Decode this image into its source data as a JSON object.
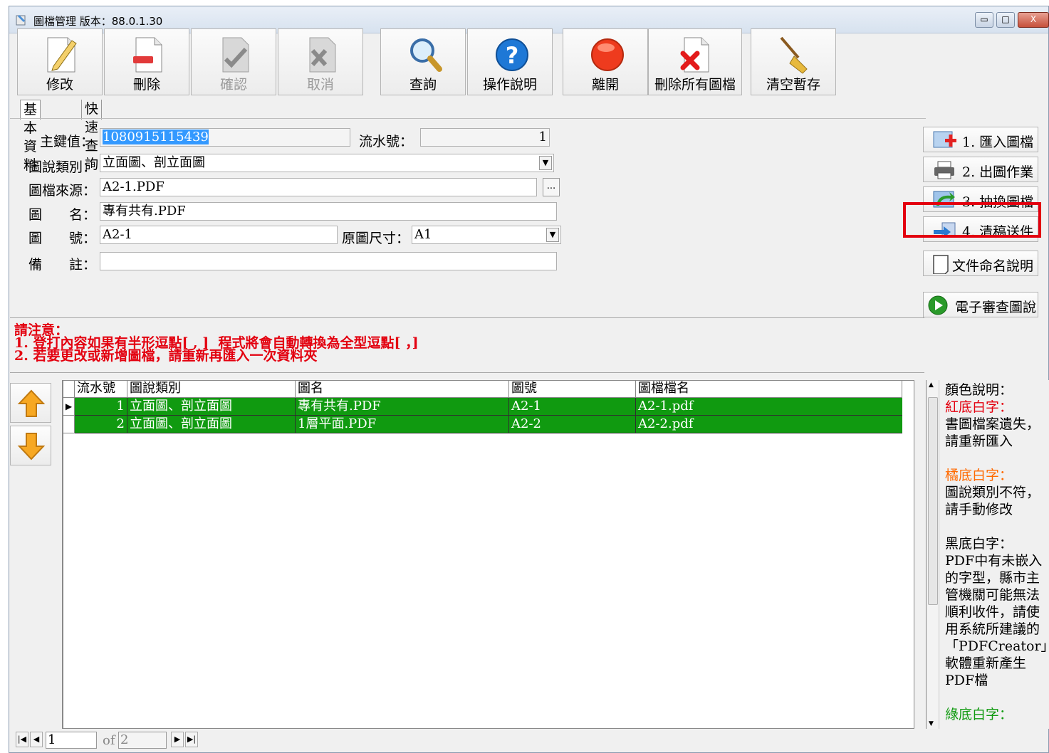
{
  "window": {
    "title": "圖檔管理 版本：88.0.1.30",
    "minimize": "▭",
    "maximize": "□",
    "close": "X"
  },
  "toolbar": [
    {
      "label": "修改",
      "icon": "edit-icon",
      "enabled": true
    },
    {
      "label": "刪除",
      "icon": "delete-doc-icon",
      "enabled": true
    },
    {
      "label": "確認",
      "icon": "confirm-icon",
      "enabled": false
    },
    {
      "label": "取消",
      "icon": "cancel-icon",
      "enabled": false
    },
    {
      "label": "查詢",
      "icon": "search-icon",
      "enabled": true
    },
    {
      "label": "操作說明",
      "icon": "help-icon",
      "enabled": true
    },
    {
      "label": "離開",
      "icon": "exit-icon",
      "enabled": true
    },
    {
      "label": "刪除所有圖檔",
      "icon": "delete-all-icon",
      "enabled": true
    },
    {
      "label": "清空暫存",
      "icon": "broom-icon",
      "enabled": true
    }
  ],
  "tabs": [
    {
      "label": "基本資料",
      "active": true
    },
    {
      "label": "快速查詢",
      "active": false
    }
  ],
  "form": {
    "key_label": "主鍵值：",
    "key_value": "1080915115439",
    "serial_label": "流水號：",
    "serial_value": "1",
    "category_label": "圖說類別：",
    "category_value": "立面圖、剖立面圖",
    "source_label": "圖檔來源：",
    "source_value": "A2-1.PDF",
    "browse_label": "...",
    "name_label": "圖　　名：",
    "name_value": "專有共有.PDF",
    "number_label": "圖　　號：",
    "number_value": "A2-1",
    "size_label": "原圖尺寸：",
    "size_value": "A1",
    "remark_label": "備　　註：",
    "remark_value": ""
  },
  "side_buttons": [
    {
      "label": "1. 匯入圖檔",
      "icon": "import-image-icon"
    },
    {
      "label": "2. 出圖作業",
      "icon": "printer-icon"
    },
    {
      "label": "3. 抽換圖檔",
      "icon": "swap-image-icon"
    },
    {
      "label": "4. 清稿送件",
      "icon": "send-icon",
      "highlighted": true
    },
    {
      "label": "文件命名說明",
      "icon": "document-icon"
    },
    {
      "label": "電子審查圖說",
      "icon": "play-icon"
    }
  ],
  "notice": {
    "title": "請注意：",
    "line1": "1. 登打內容如果有半形逗點[ , ]  程式將會自動轉換為全型逗點[ ，]",
    "line2": "2. 若要更改或新增圖檔，請重新再匯入一次資料夾"
  },
  "grid": {
    "columns": [
      "流水號",
      "圖說類別",
      "圖名",
      "圖號",
      "圖檔檔名"
    ],
    "rows": [
      {
        "serial": "1",
        "category": "立面圖、剖立面圖",
        "name": "專有共有.PDF",
        "number": "A2-1",
        "file": "A2-1.pdf",
        "current": true
      },
      {
        "serial": "2",
        "category": "立面圖、剖立面圖",
        "name": "1層平面.PDF",
        "number": "A2-2",
        "file": "A2-2.pdf",
        "current": false
      }
    ],
    "row_color": "#109a10"
  },
  "legend": {
    "heading": "顏色說明：",
    "red_title": "紅底白字：",
    "red_desc1": "書圖檔案遺失，",
    "red_desc2": "請重新匯入",
    "orange_title": "橘底白字：",
    "orange_desc1": "圖說類別不符，",
    "orange_desc2": "請手動修改",
    "black_title": "黑底白字：",
    "black_desc": [
      "PDF中有未嵌入",
      "的字型，縣市主",
      "管機關可能無法",
      "順利收件，請使",
      "用系統所建議的",
      "「PDFCreator」",
      "軟體重新產生",
      "PDF檔"
    ],
    "green_title": "綠底白字："
  },
  "pager": {
    "current": "1",
    "of_label": "of",
    "total": "2"
  },
  "colors": {
    "notice_red": "#e3000f",
    "highlight_red": "#e3000f",
    "orange": "#ff6a00",
    "green": "#109a10"
  }
}
